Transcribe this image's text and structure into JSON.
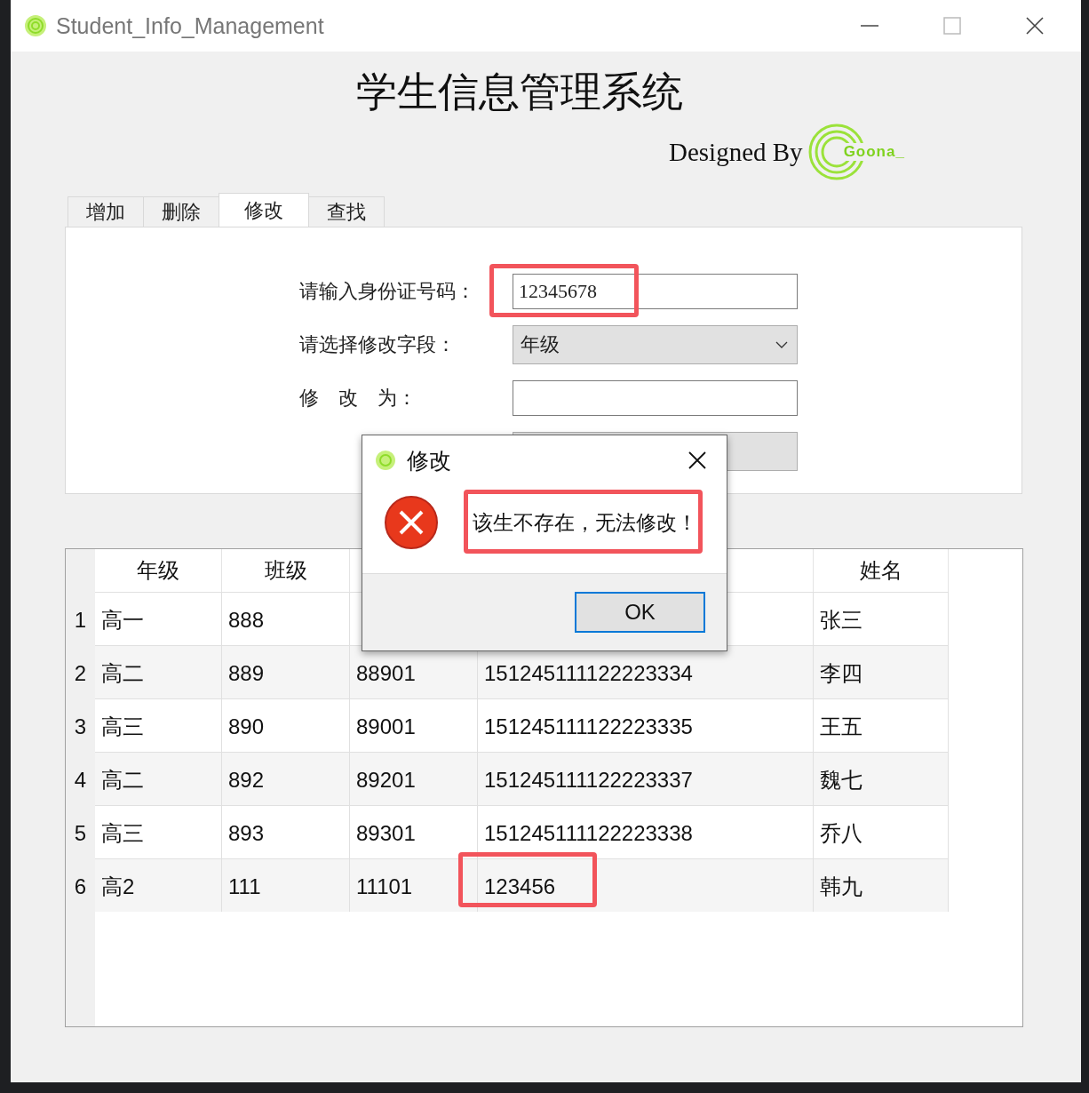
{
  "window": {
    "title": "Student_Info_Management"
  },
  "header": {
    "title": "学生信息管理系统",
    "credit": "Designed By",
    "logo_text": "Goona_"
  },
  "tabs": [
    {
      "label": "增加",
      "selected": false
    },
    {
      "label": "删除",
      "selected": false
    },
    {
      "label": "修改",
      "selected": true
    },
    {
      "label": "查找",
      "selected": false
    }
  ],
  "form": {
    "fields": [
      {
        "kind": "input",
        "label": "请输入身份证号码：",
        "value": "12345678",
        "highlighted": true
      },
      {
        "kind": "select",
        "label": "请选择修改字段：",
        "value": "年级",
        "highlighted": false
      },
      {
        "kind": "input",
        "label": "修　改　为：",
        "highlighted": false
      }
    ]
  },
  "table": {
    "columns": [
      "年级",
      "班级",
      null,
      null,
      "姓名"
    ],
    "rows": [
      {
        "index": "1",
        "cells": [
          {
            "text": "高一",
            "highlighted": false
          },
          {
            "text": "888",
            "highlighted": false
          },
          {
            "highlighted": false
          },
          {
            "highlighted": false
          },
          {
            "text": "张三",
            "highlighted": false
          }
        ]
      },
      {
        "index": "2",
        "cells": [
          {
            "text": "高二",
            "highlighted": false
          },
          {
            "text": "889",
            "highlighted": false
          },
          {
            "text": "88901",
            "highlighted": false
          },
          {
            "text": "151245111122223334",
            "highlighted": false
          },
          {
            "text": "李四",
            "highlighted": false
          }
        ]
      },
      {
        "index": "3",
        "cells": [
          {
            "text": "高三",
            "highlighted": false
          },
          {
            "text": "890",
            "highlighted": false
          },
          {
            "text": "89001",
            "highlighted": false
          },
          {
            "text": "151245111122223335",
            "highlighted": false
          },
          {
            "text": "王五",
            "highlighted": false
          }
        ]
      },
      {
        "index": "4",
        "cells": [
          {
            "text": "高二",
            "highlighted": false
          },
          {
            "text": "892",
            "highlighted": false
          },
          {
            "text": "89201",
            "highlighted": false
          },
          {
            "text": "151245111122223337",
            "highlighted": false
          },
          {
            "text": "魏七",
            "highlighted": false
          }
        ]
      },
      {
        "index": "5",
        "cells": [
          {
            "text": "高三",
            "highlighted": false
          },
          {
            "text": "893",
            "highlighted": false
          },
          {
            "text": "89301",
            "highlighted": false
          },
          {
            "text": "151245111122223338",
            "highlighted": false
          },
          {
            "text": "乔八",
            "highlighted": false
          }
        ]
      },
      {
        "index": "6",
        "cells": [
          {
            "text": "高2",
            "highlighted": false
          },
          {
            "text": "111",
            "highlighted": false
          },
          {
            "text": "11101",
            "highlighted": false
          },
          {
            "text": "123456",
            "highlighted": true
          },
          {
            "text": "韩九",
            "highlighted": false
          }
        ]
      }
    ]
  },
  "dialog": {
    "title": "修改",
    "message": "该生不存在，无法修改！",
    "message_highlighted": true,
    "button": "OK"
  }
}
